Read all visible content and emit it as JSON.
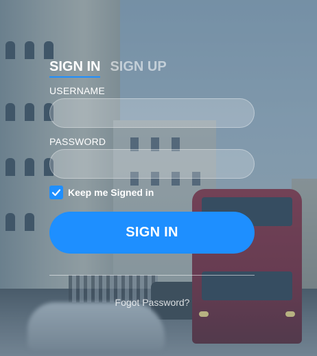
{
  "tabs": {
    "sign_in": "SIGN IN",
    "sign_up": "SIGN UP"
  },
  "form": {
    "username_label": "USERNAME",
    "username_value": "",
    "password_label": "PASSWORD",
    "password_value": "",
    "keep_signed_in_label": "Keep me Signed in",
    "keep_signed_in_checked": true,
    "submit_label": "SIGN IN",
    "forgot_password_label": "Fogot Password?"
  },
  "colors": {
    "accent": "#1e8fff",
    "text": "#ffffff"
  },
  "icons": {
    "checkbox": "checkmark-icon"
  }
}
